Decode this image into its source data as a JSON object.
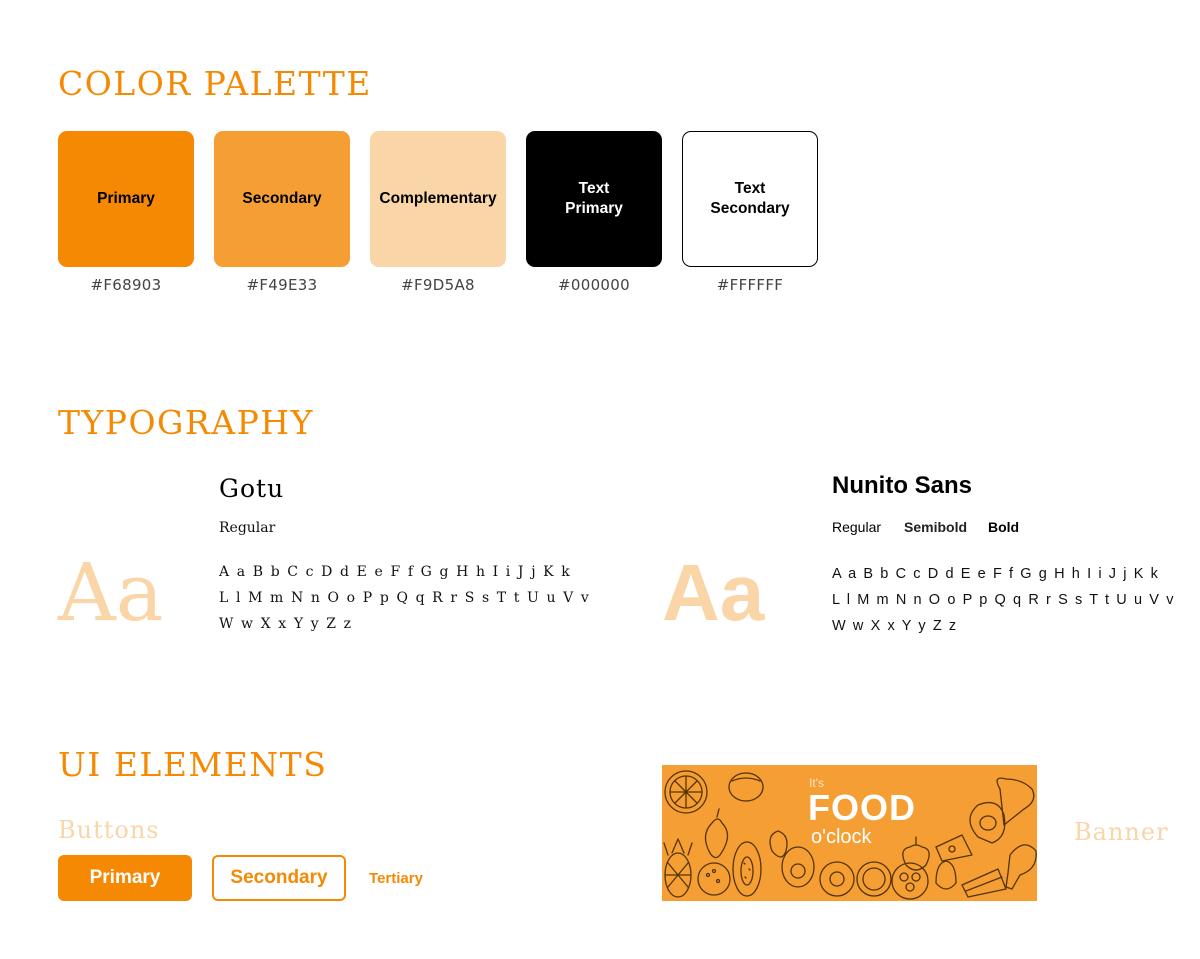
{
  "sections": {
    "color_palette": "COLOR PALETTE",
    "typography": "TYPOGRAPHY",
    "ui_elements": "UI ELEMENTS"
  },
  "palette": [
    {
      "label": "Primary",
      "hex": "#F68903",
      "color": "#F68903",
      "text_color": "#000000"
    },
    {
      "label": "Secondary",
      "hex": "#F49E33",
      "color": "#F49E33",
      "text_color": "#000000"
    },
    {
      "label": "Complementary",
      "hex": "#F9D5A8",
      "color": "#F9D5A8",
      "text_color": "#000000"
    },
    {
      "label": "Text\nPrimary",
      "hex": "#000000",
      "color": "#000000",
      "text_color": "#FFFFFF"
    },
    {
      "label": "Text\nSecondary",
      "hex": "#FFFFFF",
      "color": "#FFFFFF",
      "text_color": "#000000"
    }
  ],
  "typography": {
    "gotu": {
      "sample": "Aa",
      "name": "Gotu",
      "weights": [
        "Regular"
      ],
      "glyphs": "A a B b C c D d E e F f G g H h I i J j K k\nL l M m N n O o P p Q q R r S s T t U u V v\nW w X x Y y Z z"
    },
    "nunito": {
      "sample": "Aa",
      "name": "Nunito Sans",
      "weights": [
        "Regular",
        "Semibold",
        "Bold"
      ],
      "glyphs": "A a B b C c D d E e F f G g H h I i J j K k\nL l M m N n O o P p Q q R r S s T t U u V v\nW w X x Y y Z z"
    }
  },
  "ui": {
    "buttons_label": "Buttons",
    "primary_button": "Primary",
    "secondary_button": "Secondary",
    "tertiary_button": "Tertiary",
    "banner_label": "Banner",
    "banner": {
      "line1": "It's",
      "line2": "FOOD",
      "line3": "o'clock",
      "background": "#F49E33"
    }
  },
  "colors": {
    "accent": "#F68903",
    "light_accent": "#F9D5A8"
  }
}
